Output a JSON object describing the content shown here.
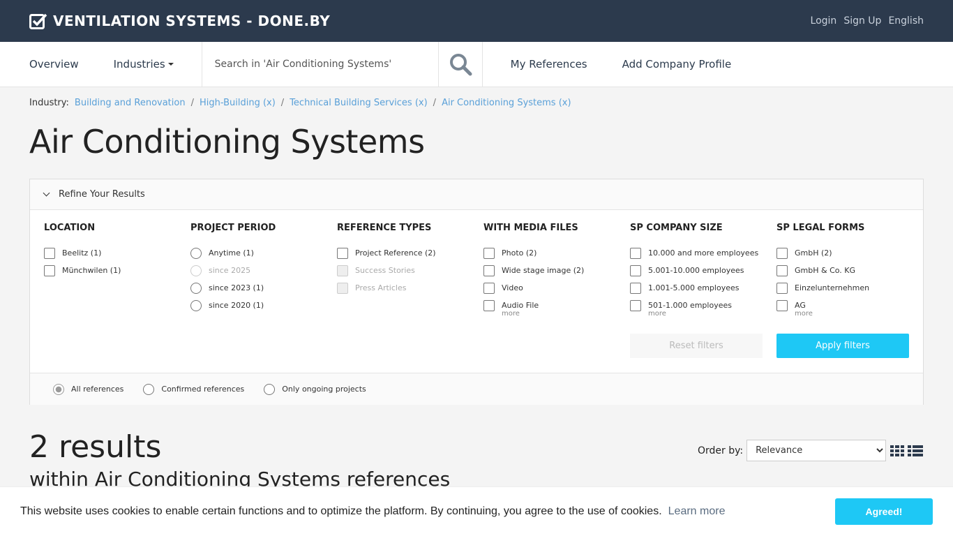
{
  "brand": {
    "title": "VENTILATION SYSTEMS - DONE.BY"
  },
  "topnav": {
    "login": "Login",
    "signup": "Sign Up",
    "language": "English"
  },
  "nav": {
    "overview": "Overview",
    "industries": "Industries",
    "search_placeholder": "Search in 'Air Conditioning Systems'",
    "my_references": "My References",
    "add_company": "Add Company Profile"
  },
  "breadcrumb": {
    "label": "Industry:",
    "items": [
      "Building and Renovation",
      "High-Building (x)",
      "Technical Building Services (x)",
      "Air Conditioning Systems (x)"
    ]
  },
  "page": {
    "title": "Air Conditioning Systems"
  },
  "filters": {
    "heading": "Refine Your Results",
    "location": {
      "title": "LOCATION",
      "options": [
        "Beelitz (1)",
        "Münchwilen (1)"
      ]
    },
    "period": {
      "title": "PROJECT PERIOD",
      "options": [
        "Anytime (1)",
        "since 2025",
        "since 2023 (1)",
        "since 2020 (1)"
      ]
    },
    "reftypes": {
      "title": "REFERENCE TYPES",
      "options": [
        "Project Reference (2)",
        "Success Stories",
        "Press Articles"
      ]
    },
    "media": {
      "title": "WITH MEDIA FILES",
      "options": [
        "Photo (2)",
        "Wide stage image (2)",
        "Video",
        "Audio File"
      ],
      "more": "more"
    },
    "size": {
      "title": "SP COMPANY SIZE",
      "options": [
        "10.000 and more employees",
        "5.001-10.000 employees",
        "1.001-5.000 employees",
        "501-1.000 employees"
      ],
      "more": "more"
    },
    "legal": {
      "title": "SP LEGAL FORMS",
      "options": [
        "GmbH (2)",
        "GmbH & Co. KG",
        "Einzelunternehmen",
        "AG"
      ],
      "more": "more"
    },
    "reset": "Reset filters",
    "apply": "Apply filters",
    "scope": [
      "All references",
      "Confirmed references",
      "Only ongoing projects"
    ]
  },
  "results": {
    "count": "2 results",
    "subtitle": "within Air Conditioning Systems references",
    "order_label": "Order by:",
    "order_value": "Relevance"
  },
  "cookie": {
    "text": "This website uses cookies to enable certain functions and to optimize the platform. By continuing, you agree to the use of cookies.",
    "learn_more": "Learn more",
    "agree": "Agreed!"
  }
}
